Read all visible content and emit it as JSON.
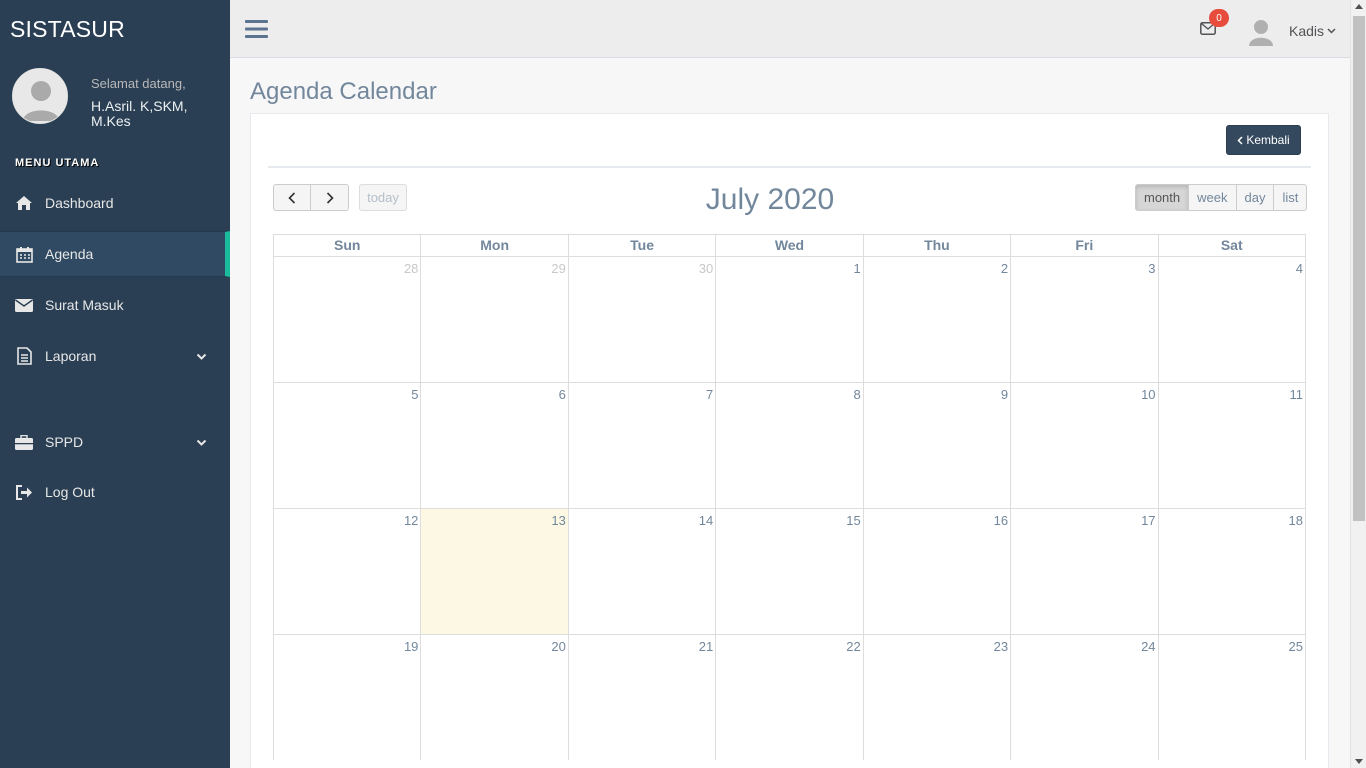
{
  "sidebar": {
    "brand": "SISTASUR",
    "welcome": "Selamat datang,",
    "user_name": "H.Asril. K,SKM, M.Kes",
    "menu_title": "MENU UTAMA",
    "items": [
      {
        "label": "Dashboard",
        "icon": "home-icon"
      },
      {
        "label": "Agenda",
        "icon": "calendar-icon",
        "active": true
      },
      {
        "label": "Surat Masuk",
        "icon": "envelope-icon"
      },
      {
        "label": "Laporan",
        "icon": "document-icon",
        "has_submenu": true
      },
      {
        "label": "SPPD",
        "icon": "briefcase-icon",
        "has_submenu": true
      },
      {
        "label": "Log Out",
        "icon": "sign-out-icon"
      }
    ]
  },
  "topnav": {
    "notification_count": "0",
    "user": "Kadis"
  },
  "page": {
    "title": "Agenda Calendar",
    "back_button": "Kembali"
  },
  "calendar": {
    "title": "July 2020",
    "today_label": "today",
    "views": [
      "month",
      "week",
      "day",
      "list"
    ],
    "active_view": "month",
    "weekdays": [
      "Sun",
      "Mon",
      "Tue",
      "Wed",
      "Thu",
      "Fri",
      "Sat"
    ],
    "weeks": [
      [
        "28",
        "29",
        "30",
        "1",
        "2",
        "3",
        "4"
      ],
      [
        "5",
        "6",
        "7",
        "8",
        "9",
        "10",
        "11"
      ],
      [
        "12",
        "13",
        "14",
        "15",
        "16",
        "17",
        "18"
      ],
      [
        "19",
        "20",
        "21",
        "22",
        "23",
        "24",
        "25"
      ]
    ],
    "other_month_days": [
      "28",
      "29",
      "30"
    ],
    "today": "13"
  },
  "colors": {
    "sidebar_bg": "#2a3f54",
    "active_accent": "#1abb9c",
    "text_muted": "#73879c",
    "today_bg": "#fcf8e3",
    "badge": "#e74c3c",
    "button_dark": "#34495e"
  }
}
